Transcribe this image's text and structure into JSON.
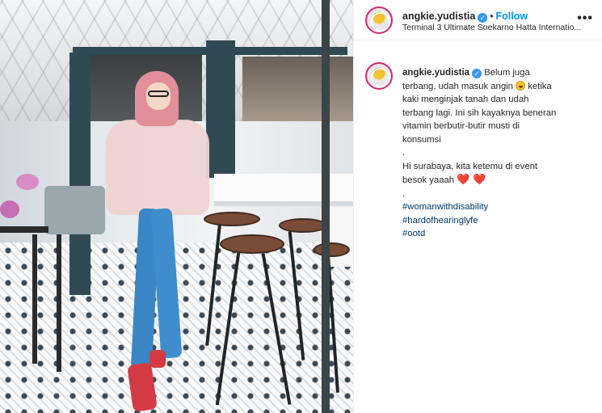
{
  "post": {
    "username": "angkie.yudistia",
    "follow_label": "Follow",
    "separator": "•",
    "location": "Terminal 3 Ultimate Soekarno Hatta Internatio...",
    "more_label": "•••",
    "photo_alt": ""
  },
  "caption": {
    "username": "angkie.yudistia",
    "line1_a": "Belum juga",
    "line2_a": "terbang, udah masuk angin",
    "line2_b": "ketika",
    "line3": "kaki menginjak tanah dan udah",
    "line4": "terbang lagi. Ini sih kayaknya beneran",
    "line5": "vitamin berbutir-butir musti di",
    "line6": "konsumsi",
    "dot1": ".",
    "line7": "Hi surabaya, kita ketemu di event",
    "line8": "besok yaaah",
    "hearts": "❤️ ❤️",
    "dot2": ".",
    "hashtags": [
      "#womanwithdisability",
      "#hardofhearinglyfe",
      "#ootd"
    ]
  },
  "icons": {
    "verified": "✓",
    "laugh_emoji": "rolling-on-floor-laughing",
    "heart_emoji": "red-heart"
  },
  "colors": {
    "follow": "#0095f6",
    "hashtag": "#00376b",
    "verified": "#3897f0",
    "story_ring": "#d62976"
  }
}
